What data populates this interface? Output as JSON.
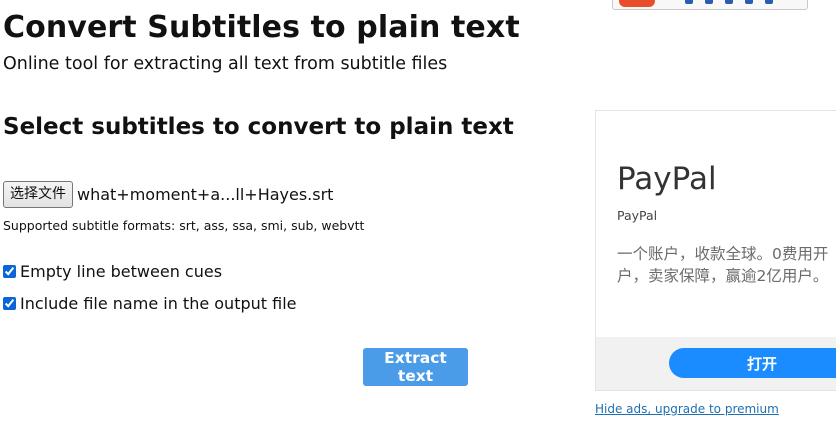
{
  "header": {
    "title": "Convert Subtitles to plain text",
    "subtitle": "Online tool for extracting all text from subtitle files"
  },
  "form": {
    "section_title": "Select subtitles to convert to plain text",
    "file_button_label": "选择文件",
    "file_name": "what+moment+a...ll+Hayes.srt",
    "formats_note": "Supported subtitle formats: srt, ass, ssa, smi, sub, webvtt",
    "options": [
      {
        "label": "Empty line between cues",
        "checked": true
      },
      {
        "label": "Include file name in the output file",
        "checked": true
      }
    ],
    "submit_label": "Extract text"
  },
  "ad": {
    "title": "PayPal",
    "advertiser": "PayPal",
    "description": "一个账户，收款全球。0费用开户，卖家保障，赢逾2亿用户。",
    "cta_label": "打开",
    "cta_color": "#1a8cff"
  },
  "hide_ads_link": "Hide ads, upgrade to premium",
  "colors": {
    "accent": "#4a9be8",
    "link": "#1f6fb0"
  }
}
